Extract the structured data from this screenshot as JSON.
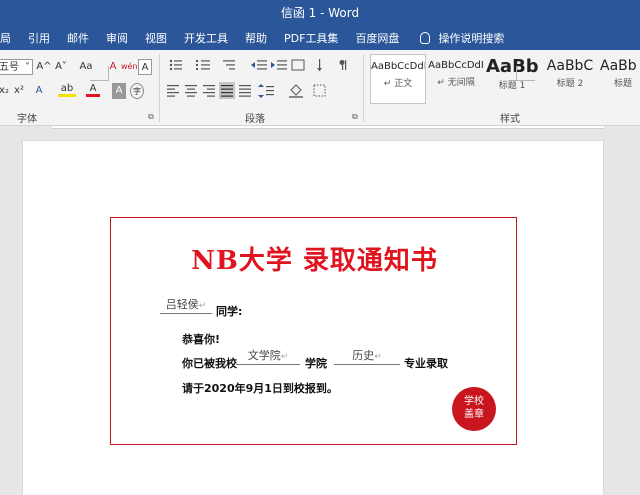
{
  "window": {
    "title": "信函 1  -  Word"
  },
  "menu": {
    "items": [
      "局",
      "引用",
      "邮件",
      "审阅",
      "视图",
      "开发工具",
      "帮助",
      "PDF工具集",
      "百度网盘"
    ],
    "search_label": "操作说明搜索"
  },
  "ribbon": {
    "font": {
      "size_value": "五号",
      "grow_label": "A^",
      "shrink_label": "A˅",
      "case_label": "Aa",
      "clear_label": "A",
      "phonetic_label": "wén",
      "border_char_label": "A",
      "subscript_label": "x₂",
      "superscript_label": "x²",
      "effects_label": "A",
      "highlight_label": "ab",
      "font_color_label": "A",
      "shading_label": "A",
      "enclose_label": "字",
      "group_label": "字体"
    },
    "paragraph": {
      "group_label": "段落"
    },
    "styles": {
      "group_label": "样式",
      "cards": [
        {
          "sample": "AaBbCcDdI",
          "name": "↵ 正文",
          "active": true
        },
        {
          "sample": "AaBbCcDdI",
          "name": "↵ 无间隔"
        },
        {
          "sample": "AaBb",
          "name": "标题 1"
        },
        {
          "sample": "AaBbC",
          "name": "标题 2"
        },
        {
          "sample": "AaBb",
          "name": "标题"
        }
      ]
    }
  },
  "colors": {
    "accent": "#2b579a",
    "notice_red": "#e0141e",
    "border_red": "#c9151e"
  },
  "document": {
    "title": "NB大学 录取通知书",
    "student_name": "吕轻侯",
    "greeting_suffix": "同学:",
    "congrats": "恭喜你!",
    "admit_prefix": "你已被我校",
    "college_value": "文学院",
    "college_suffix": "学院",
    "major_value": "历史",
    "major_suffix": "专业录取",
    "report_line": "请于2020年9月1日到校报到。",
    "para_mark": "↵",
    "seal_line1": "学校",
    "seal_line2": "盖章"
  }
}
